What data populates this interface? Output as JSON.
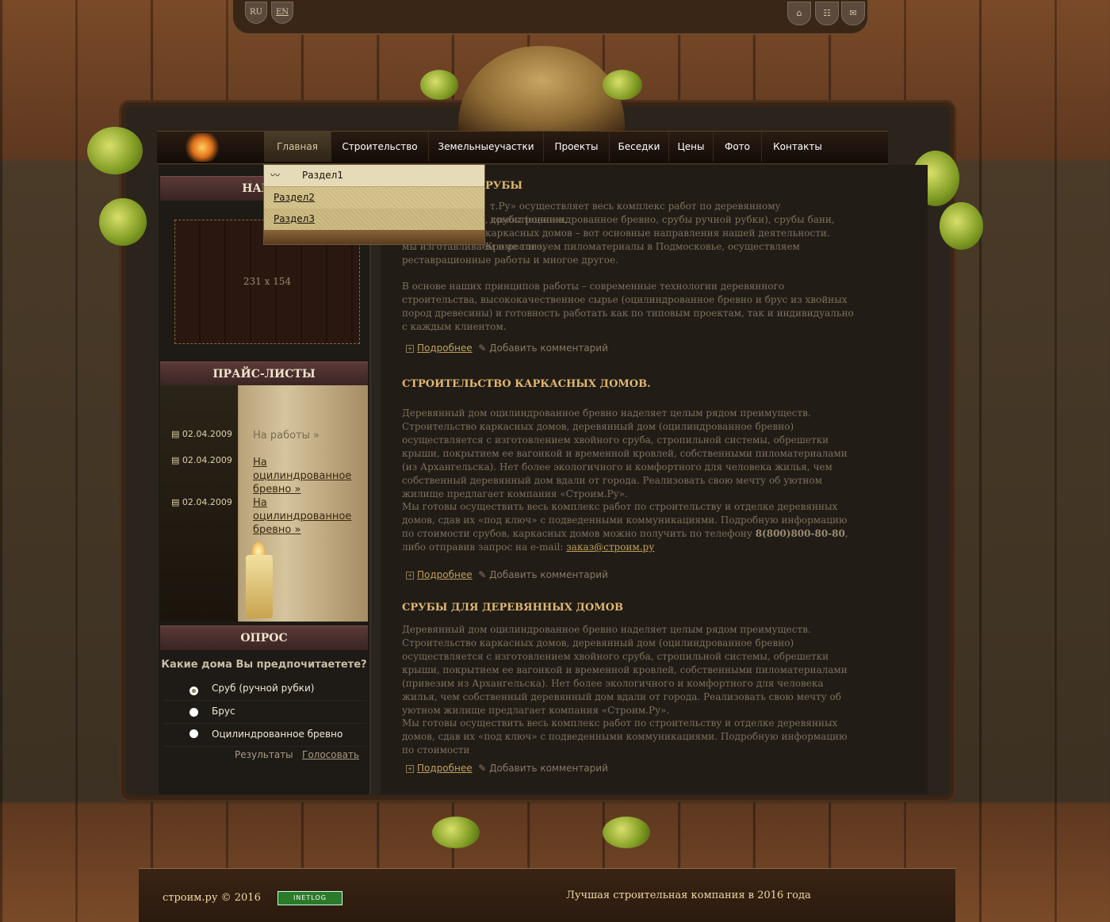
{
  "lang": {
    "ru": "RU",
    "en": "EN"
  },
  "top_icons": [
    "home-icon",
    "sitemap-icon",
    "mail-icon"
  ],
  "nav": [
    "Главная",
    "Строительство",
    "Земельныеучастки",
    "Проекты",
    "Беседки",
    "Цены",
    "Фото",
    "Контакты"
  ],
  "dropdown": [
    "Раздел1",
    "Раздел2",
    "Раздел3"
  ],
  "left": {
    "our_header": "НАШИ",
    "placeholder": "231 x 154",
    "price_header": "ПРАЙС-ЛИСТЫ",
    "price_items": [
      {
        "date": "02.04.2009",
        "title": "На работы",
        "link": false
      },
      {
        "date": "02.04.2009",
        "title": "На оцилиндрованное бревно",
        "link": true
      },
      {
        "date": "02.04.2009",
        "title": "На оцилиндрованное бревно",
        "link": true
      }
    ],
    "poll_header": "ОПРОС",
    "poll_question": "Какие дома Вы предпочитаетете?",
    "poll_options": [
      "Сруб (ручной рубки)",
      "Брус",
      "Оцилиндрованное бревно"
    ],
    "poll_results": "Результаты",
    "poll_vote": "Голосовать"
  },
  "articles": [
    {
      "title": "РУБЫ",
      "p1": "т.Ру» осуществляет весь комплекс работ по деревянному домостроению.",
      "p1b": ", срубы (оцилиндрованное бревно, срубы ручной рубки), срубы бани,",
      "p1c": "каркасных домов – вот основные направления нашей деятельности. Кроме того,",
      "p1d": "мы изготавливаем и реализуем пиломатериалы в Подмосковье, осуществляем реставрационные работы и многое другое.",
      "p2": "В основе наших принципов работы – современные технологии деревянного строительства, высококачественное сырье (оцилиндрованное бревно и брус из хвойных пород древесины) и готовность работать как по типовым проектам, так и  индивидуально с каждым клиентом."
    },
    {
      "title": "СТРОИТЕЛЬСТВО КАРКАСНЫХ ДОМОВ.",
      "p1": "Деревянный дом оцилиндрованное бревно наделяет целым рядом преимуществ. Строительство каркасных домов, деревянный дом (оцилиндрованное бревно) осуществляется с изготовлением хвойного сруба, стропильной системы, обрешетки крыши, покрытием ее вагонкой и временной кровлей, собственными пиломатериалами (из Архангельска). Нет более экологичного и комфортного для человека жилья, чем собственный деревянный дом вдали от города. Реализовать свою мечту об уютном жилище предлагает компания «Строим.Ру».",
      "p2": "Мы готовы осуществить весь комплекс работ по строительству и отделке деревянных домов, сдав их «под ключ» с подведенными коммуникациями. Подробную информацию по стоимости срубов, каркасных домов можно получить по телефону",
      "phone": "8(800)800-80-80",
      "p2b": ", либо отправив запрос на e-mail:",
      "email": "заказ@строим.ру"
    },
    {
      "title": "СРУБЫ ДЛЯ ДЕРЕВЯННЫХ ДОМОВ",
      "p1": "Деревянный дом оцилиндрованное бревно наделяет целым рядом преимуществ. Строительство каркасных домов, деревянный дом (оцилиндрованное бревно) осуществляется с изготовлением хвойного сруба, стропильной системы, обрешетки крыши, покрытием ее вагонкой и временной кровлей, собственными пиломатериалами (привезим из Архангельска). Нет более экологичного и комфортного для человека жилья, чем собственный деревянный дом вдали от города. Реализовать свою мечту об уютном жилище предлагает компания «Строим.Ру».",
      "p2": "Мы готовы осуществить весь комплекс работ по строительству и отделке деревянных домов, сдав их «под ключ» с подведенными коммуникациями. Подробную информацию по стоимости"
    }
  ],
  "more_label": "Подробнее",
  "comment_label": "Добавить комментарий",
  "footer": {
    "copyright": "строим.ру © 2016",
    "counter": "INETLOG",
    "slogan": "Лучшая строительная компания в 2016 года"
  }
}
